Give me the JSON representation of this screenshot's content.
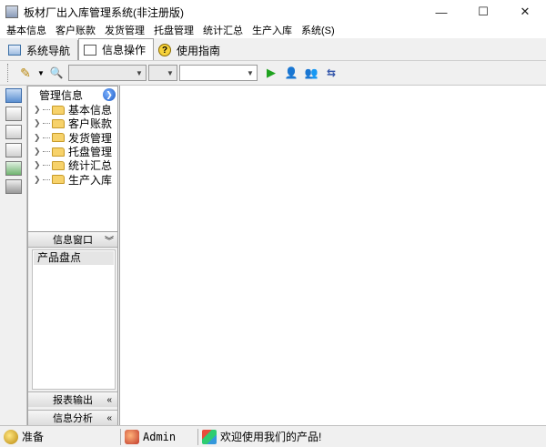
{
  "window": {
    "title": "板材厂出入库管理系统(非注册版)",
    "controls": {
      "minimize": "—",
      "maximize": "☐",
      "close": "✕"
    }
  },
  "menu": [
    "基本信息",
    "客户账款",
    "发货管理",
    "托盘管理",
    "统计汇总",
    "生产入库",
    "系统(S)"
  ],
  "tabs": [
    {
      "label": "系统导航",
      "icon": "monitor-icon",
      "active": false
    },
    {
      "label": "信息操作",
      "icon": "window-icon",
      "active": true
    },
    {
      "label": "使用指南",
      "icon": "help-icon",
      "active": false
    }
  ],
  "toolbar": {
    "icons": [
      "pencil-icon",
      "dropdown-arrow",
      "search-document-icon",
      "play-icon",
      "search-user-icon",
      "search-user2-icon",
      "refresh-icon"
    ],
    "combo_values": [
      "",
      "",
      ""
    ]
  },
  "sidebar": {
    "icons": [
      "nav-screen-icon",
      "tree-structure-icon",
      "grid-icon",
      "document-icon",
      "chart-icon",
      "trash-icon"
    ]
  },
  "panel": {
    "title": "管理信息",
    "tree": [
      "基本信息",
      "客户账款",
      "发货管理",
      "托盘管理",
      "统计汇总",
      "生产入库"
    ]
  },
  "dock": {
    "title": "信息窗口",
    "items": [
      "产品盘点"
    ],
    "footers": [
      "报表输出",
      "信息分析"
    ]
  },
  "status": {
    "state": "准备",
    "user": "Admin",
    "message": "欢迎使用我们的产品!"
  }
}
